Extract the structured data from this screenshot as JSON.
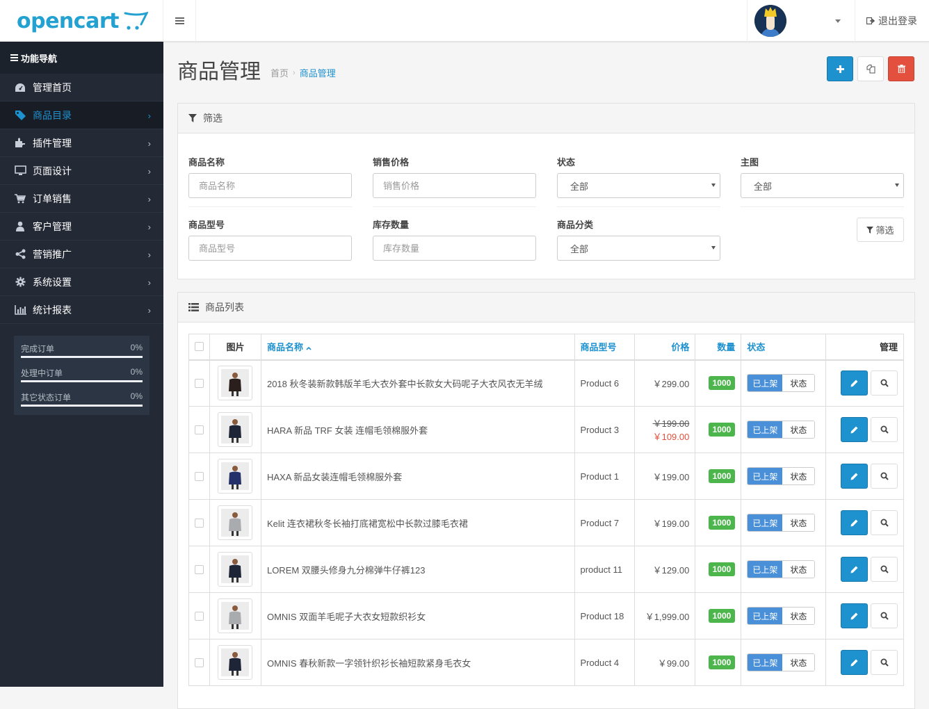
{
  "header": {
    "logo_text": "opencart",
    "logout_label": "退出登录"
  },
  "sidebar": {
    "title": "功能导航",
    "items": [
      {
        "label": "管理首页",
        "icon": "dashboard-icon",
        "active": false,
        "has_children": false
      },
      {
        "label": "商品目录",
        "icon": "tag-icon",
        "active": true,
        "has_children": true
      },
      {
        "label": "插件管理",
        "icon": "puzzle-icon",
        "active": false,
        "has_children": true
      },
      {
        "label": "页面设计",
        "icon": "desktop-icon",
        "active": false,
        "has_children": true
      },
      {
        "label": "订单销售",
        "icon": "cart-icon",
        "active": false,
        "has_children": true
      },
      {
        "label": "客户管理",
        "icon": "user-icon",
        "active": false,
        "has_children": true
      },
      {
        "label": "营销推广",
        "icon": "share-icon",
        "active": false,
        "has_children": true
      },
      {
        "label": "系统设置",
        "icon": "gear-icon",
        "active": false,
        "has_children": true
      },
      {
        "label": "统计报表",
        "icon": "bar-chart-icon",
        "active": false,
        "has_children": true
      }
    ],
    "stats": [
      {
        "label": "完成订单",
        "value": "0%",
        "percent": 0
      },
      {
        "label": "处理中订单",
        "value": "0%",
        "percent": 0
      },
      {
        "label": "其它状态订单",
        "value": "0%",
        "percent": 0
      }
    ]
  },
  "page": {
    "title": "商品管理",
    "breadcrumb": [
      "首页",
      "商品管理"
    ]
  },
  "filter": {
    "title": "筛选",
    "fields": {
      "name": {
        "label": "商品名称",
        "placeholder": "商品名称",
        "value": ""
      },
      "price": {
        "label": "销售价格",
        "placeholder": "销售价格",
        "value": ""
      },
      "status": {
        "label": "状态",
        "selected": "全部"
      },
      "image": {
        "label": "主图",
        "selected": "全部"
      },
      "model": {
        "label": "商品型号",
        "placeholder": "商品型号",
        "value": ""
      },
      "quantity": {
        "label": "库存数量",
        "placeholder": "库存数量",
        "value": ""
      },
      "category": {
        "label": "商品分类",
        "selected": "全部"
      }
    },
    "button_label": "筛选"
  },
  "list": {
    "title": "商品列表",
    "columns": [
      "图片",
      "商品名称",
      "商品型号",
      "价格",
      "数量",
      "状态",
      "管理"
    ],
    "rows": [
      {
        "name": "2018 秋冬装新款韩版羊毛大衣外套中长款女大码呢子大衣风衣无羊绒",
        "model": "Product 6",
        "price": "￥299.00",
        "special": "",
        "quantity": "1000",
        "status_on": "已上架",
        "status_off": "状态",
        "thumb_color": "#2a1f1c"
      },
      {
        "name": "HARA 新品 TRF 女装 连帽毛领棉服外套",
        "model": "Product 3",
        "price": "￥199.00",
        "special": "￥109.00",
        "quantity": "1000",
        "status_on": "已上架",
        "status_off": "状态",
        "thumb_color": "#1e2536"
      },
      {
        "name": "HAXA 新品女装连帽毛领棉服外套",
        "model": "Product 1",
        "price": "￥199.00",
        "special": "",
        "quantity": "1000",
        "status_on": "已上架",
        "status_off": "状态",
        "thumb_color": "#23306a"
      },
      {
        "name": "Kelit 连衣裙秋冬长袖打底裙宽松中长款过膝毛衣裙",
        "model": "Product 7",
        "price": "￥199.00",
        "special": "",
        "quantity": "1000",
        "status_on": "已上架",
        "status_off": "状态",
        "thumb_color": "#a9abae"
      },
      {
        "name": "LOREM 双腰头修身九分棉弹牛仔裤123",
        "model": "product 11",
        "price": "￥129.00",
        "special": "",
        "quantity": "1000",
        "status_on": "已上架",
        "status_off": "状态",
        "thumb_color": "#1e2536"
      },
      {
        "name": "OMNIS 双面羊毛呢子大衣女短款织衫女",
        "model": "Product 18",
        "price": "￥1,999.00",
        "special": "",
        "quantity": "1000",
        "status_on": "已上架",
        "status_off": "状态",
        "thumb_color": "#a9abae"
      },
      {
        "name": "OMNIS 春秋新款一字领针织衫长袖短款紧身毛衣女",
        "model": "Product 4",
        "price": "￥99.00",
        "special": "",
        "quantity": "1000",
        "status_on": "已上架",
        "status_off": "状态",
        "thumb_color": "#1e2536"
      }
    ]
  }
}
